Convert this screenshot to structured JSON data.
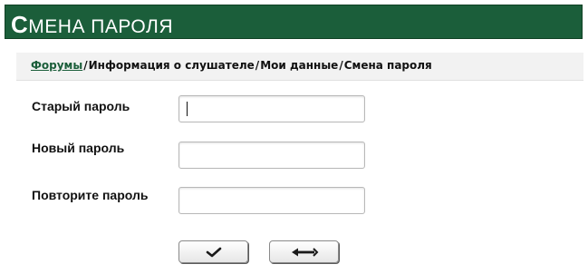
{
  "header": {
    "title": "Смена пароля",
    "title_first": "С",
    "title_rest": "мена пароля"
  },
  "breadcrumb": {
    "items": [
      {
        "label": "Форумы",
        "link": true
      },
      {
        "label": "Информация о слушателе",
        "link": false
      },
      {
        "label": "Мои данные",
        "link": false
      },
      {
        "label": "Смена пароля",
        "link": false
      }
    ],
    "separator": "/"
  },
  "form": {
    "old_password": {
      "label": "Старый пароль",
      "value": ""
    },
    "new_password": {
      "label": "Новый пароль",
      "value": ""
    },
    "repeat_password": {
      "label": "Повторите пароль",
      "value": ""
    }
  },
  "buttons": {
    "submit": {
      "icon": "checkmark-icon"
    },
    "back": {
      "icon": "back-arrow-icon"
    }
  },
  "colors": {
    "header_bg": "#1b5e3a",
    "link": "#1b5e3a"
  }
}
